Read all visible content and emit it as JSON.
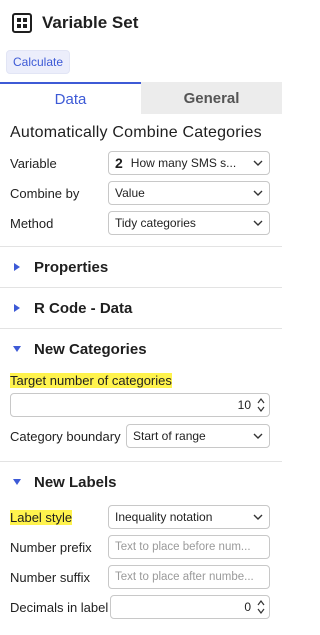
{
  "header": {
    "title": "Variable Set",
    "icon": "grid-icon"
  },
  "toolbar": {
    "calculate_label": "Calculate"
  },
  "tabs": [
    {
      "label": "Data",
      "active": true
    },
    {
      "label": "General",
      "active": false
    }
  ],
  "main": {
    "section_title": "Automatically Combine Categories",
    "variable": {
      "label": "Variable",
      "number": "2",
      "value": "How many SMS s..."
    },
    "combine_by": {
      "label": "Combine by",
      "value": "Value"
    },
    "method": {
      "label": "Method",
      "value": "Tidy categories"
    }
  },
  "sections": {
    "properties": "Properties",
    "r_code": "R Code - Data",
    "new_categories": "New Categories",
    "new_labels": "New Labels"
  },
  "new_categories": {
    "target_label": "Target number of categories",
    "target_value": "10",
    "boundary_label": "Category boundary",
    "boundary_value": "Start of range"
  },
  "new_labels": {
    "label_style_label": "Label style",
    "label_style_value": "Inequality notation",
    "prefix_label": "Number prefix",
    "prefix_placeholder": "Text to place before num...",
    "suffix_label": "Number suffix",
    "suffix_placeholder": "Text to place after numbe...",
    "decimals_label": "Decimals in label",
    "decimals_value": "0"
  },
  "colors": {
    "accent": "#3d5ad6",
    "highlight": "#fff34d",
    "tab_inactive_bg": "#ececec"
  }
}
